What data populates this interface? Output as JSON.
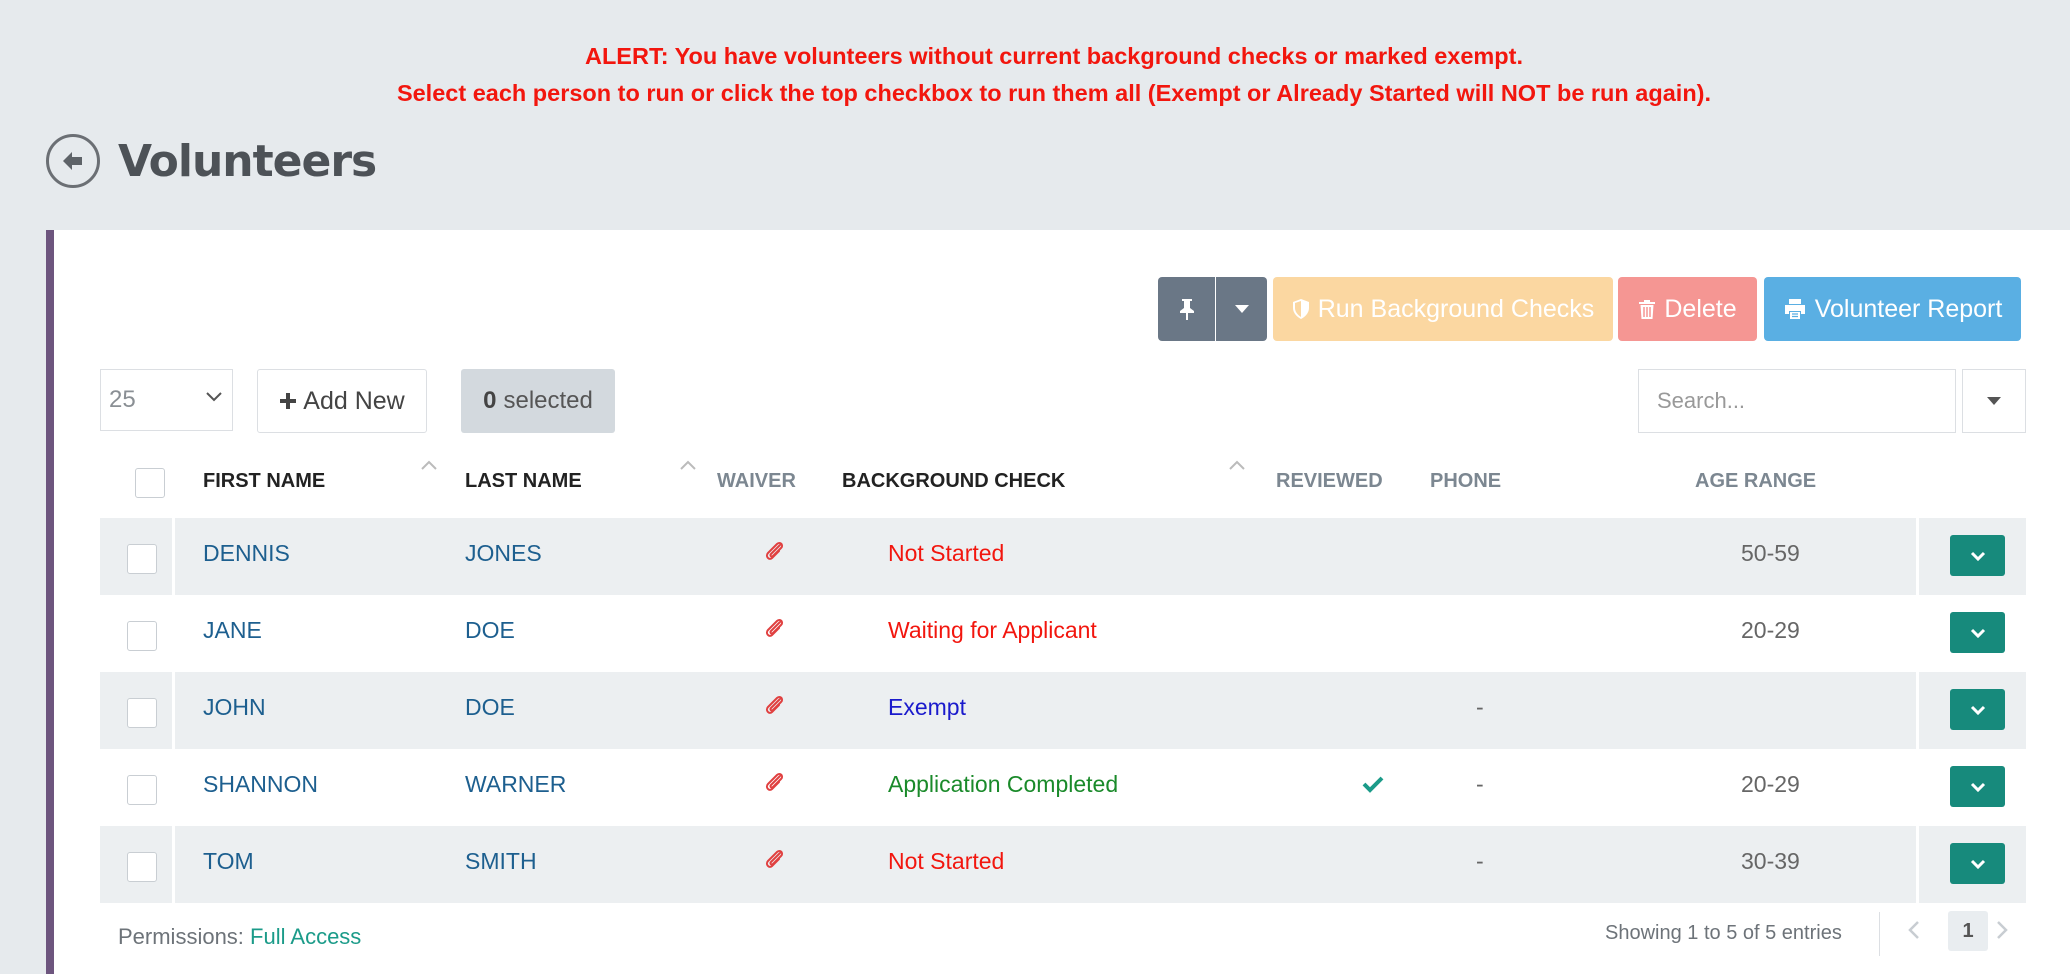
{
  "alert": {
    "line1": "ALERT: You have volunteers without current background checks or marked exempt.",
    "line2": "Select each person to run or click the top checkbox to run them all (Exempt or Already Started will NOT be run again)."
  },
  "header": {
    "title": "Volunteers",
    "back_icon": "arrow-left-circle-icon"
  },
  "toolbar": {
    "pin_icon": "pin-icon",
    "run_label": "Run Background Checks",
    "delete_label": "Delete",
    "report_label": "Volunteer Report"
  },
  "controls": {
    "page_size": "25",
    "add_new_label": "Add New",
    "selected_count": "0",
    "selected_label": "selected",
    "search_placeholder": "Search..."
  },
  "table": {
    "columns": [
      "First Name",
      "Last Name",
      "Waiver",
      "Background Check",
      "Reviewed",
      "Phone",
      "Age Range"
    ],
    "rows": [
      {
        "first": "DENNIS",
        "last": "JONES",
        "status": "Not Started",
        "status_color": "#f2160e",
        "reviewed": false,
        "phone": "",
        "age": "50-59"
      },
      {
        "first": "JANE",
        "last": "DOE",
        "status": "Waiting for Applicant",
        "status_color": "#f2160e",
        "reviewed": false,
        "phone": "",
        "age": "20-29"
      },
      {
        "first": "JOHN",
        "last": "DOE",
        "status": "Exempt",
        "status_color": "#1a1acc",
        "reviewed": false,
        "phone": "-",
        "age": ""
      },
      {
        "first": "SHANNON",
        "last": "WARNER",
        "status": "Application Completed",
        "status_color": "#1a8a2a",
        "reviewed": true,
        "phone": "-",
        "age": "20-29"
      },
      {
        "first": "TOM",
        "last": "SMITH",
        "status": "Not Started",
        "status_color": "#f2160e",
        "reviewed": false,
        "phone": "-",
        "age": "30-39"
      }
    ]
  },
  "footer": {
    "permissions_label": "Permissions:",
    "permissions_value": "Full Access",
    "showing": "Showing 1 to 5 of 5 entries",
    "current_page": "1"
  },
  "colors": {
    "accent": "#178a7c",
    "alert": "#f2160e",
    "sidebar_stripe": "#6d557e"
  }
}
